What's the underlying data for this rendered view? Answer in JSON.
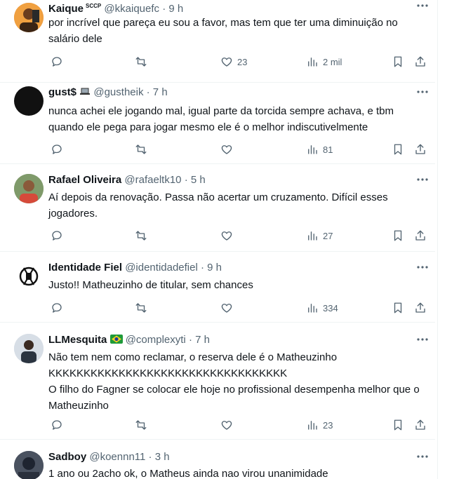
{
  "tweets": [
    {
      "name": "Kaique",
      "badge": "SCCP",
      "handle": "@kkaiquefc",
      "time": "· 9 h",
      "text": "por incrível que pareça eu sou a favor, mas tem que ter uma diminuição no salário dele",
      "likes": "23",
      "views": "2 mil",
      "avatar_color": "#d9772b"
    },
    {
      "name": "gust$",
      "handle": "@gustheik",
      "time": "· 7 h",
      "text": "nunca achei ele jogando mal, igual parte da torcida sempre achava, e tbm quando ele pega para jogar mesmo ele é o melhor indiscutivelmente",
      "views": "81",
      "avatar_color": "#111111"
    },
    {
      "name": "Rafael Oliveira",
      "handle": "@rafaeltk10",
      "time": "· 5 h",
      "text": "Aí depois da renovação.  Passa não acertar um cruzamento.   Difícil esses jogadores.",
      "views": "27",
      "avatar_color": "#6b8a5a"
    },
    {
      "name": "Identidade Fiel",
      "handle": "@identidadefiel",
      "time": "· 9 h",
      "text": "Justo!! Matheuzinho de titular, sem chances",
      "views": "334",
      "avatar_color": "#ffffff"
    },
    {
      "name": "LLMesquita",
      "handle": "@complexyti",
      "time": "· 7 h",
      "lines": [
        "Não tem nem como reclamar, o reserva dele é o Matheuzinho",
        "KKKKKKKKKKKKKKKKKKKKKKKKKKKKKKKKKK",
        "O filho do Fagner se colocar ele hoje no profissional desempenha melhor que o Matheuzinho"
      ],
      "views": "23",
      "avatar_color": "#c9d4de"
    },
    {
      "name": "Sadboy",
      "handle": "@koennn11",
      "time": "· 3 h",
      "text": "1 ano ou 2acho ok, o Matheus ainda nao virou unanimidade",
      "avatar_color": "#3d4452"
    }
  ],
  "icons": {
    "reply": "reply-icon",
    "retweet": "retweet-icon",
    "like": "heart-icon",
    "views": "views-icon",
    "bookmark": "bookmark-icon",
    "share": "share-icon",
    "more": "more-icon",
    "flag": "brazil-flag-icon",
    "laptop": "laptop-icon"
  },
  "colors": {
    "text": "#0f1419",
    "secondary": "#536471",
    "divider": "#eff3f4"
  }
}
